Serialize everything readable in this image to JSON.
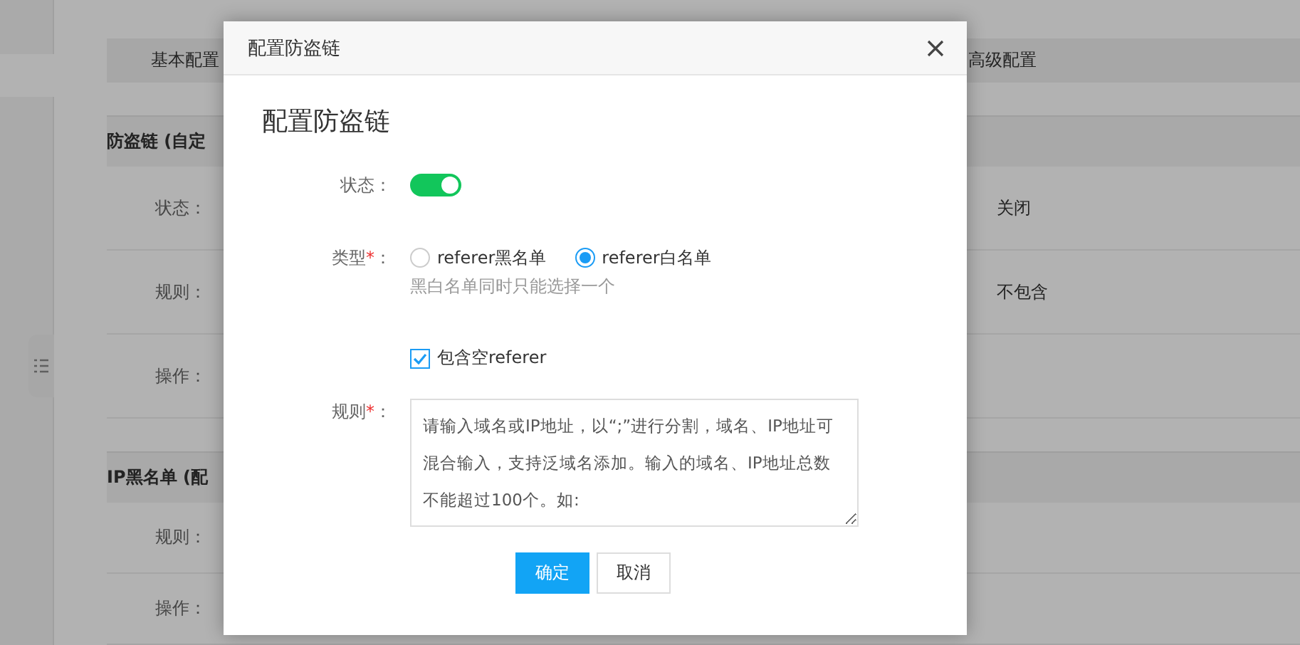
{
  "page": {
    "tabs": [
      {
        "label": "基本配置"
      },
      {
        "label": "高级配置"
      }
    ],
    "sections": [
      {
        "title": "防盗链 (自定",
        "rows": [
          {
            "label": "状态：",
            "value": "关闭"
          },
          {
            "label": "规则：",
            "value": "不包含"
          },
          {
            "label": "操作："
          }
        ]
      },
      {
        "title": "IP黑名单 (配",
        "rows": [
          {
            "label": "规则："
          },
          {
            "label": "操作："
          }
        ]
      }
    ]
  },
  "dialog": {
    "title": "配置防盗链",
    "heading": "配置防盗链",
    "fields": [
      {
        "kind": "switch",
        "label": "状态",
        "colon": "：",
        "on": true
      },
      {
        "kind": "radio",
        "label": "类型",
        "mark": "*",
        "colon": "：",
        "options": [
          {
            "label": "referer黑名单",
            "selected": false
          },
          {
            "label": "referer白名单",
            "selected": true
          }
        ],
        "hint": "黑白名单同时只能选择一个"
      },
      {
        "kind": "checkbox",
        "label": "包含空referer",
        "checked": true
      },
      {
        "kind": "textarea",
        "label": "规则",
        "mark": "*",
        "colon": "：",
        "placeholder": "请输入域名或IP地址，以“;”进行分割，域名、IP地址可混合输入，支持泛域名添加。输入的域名、IP地址总数不能超过100个。如:"
      }
    ],
    "buttons": [
      {
        "label": "确定",
        "kind": "primary"
      },
      {
        "label": "取消",
        "kind": "default"
      }
    ]
  }
}
